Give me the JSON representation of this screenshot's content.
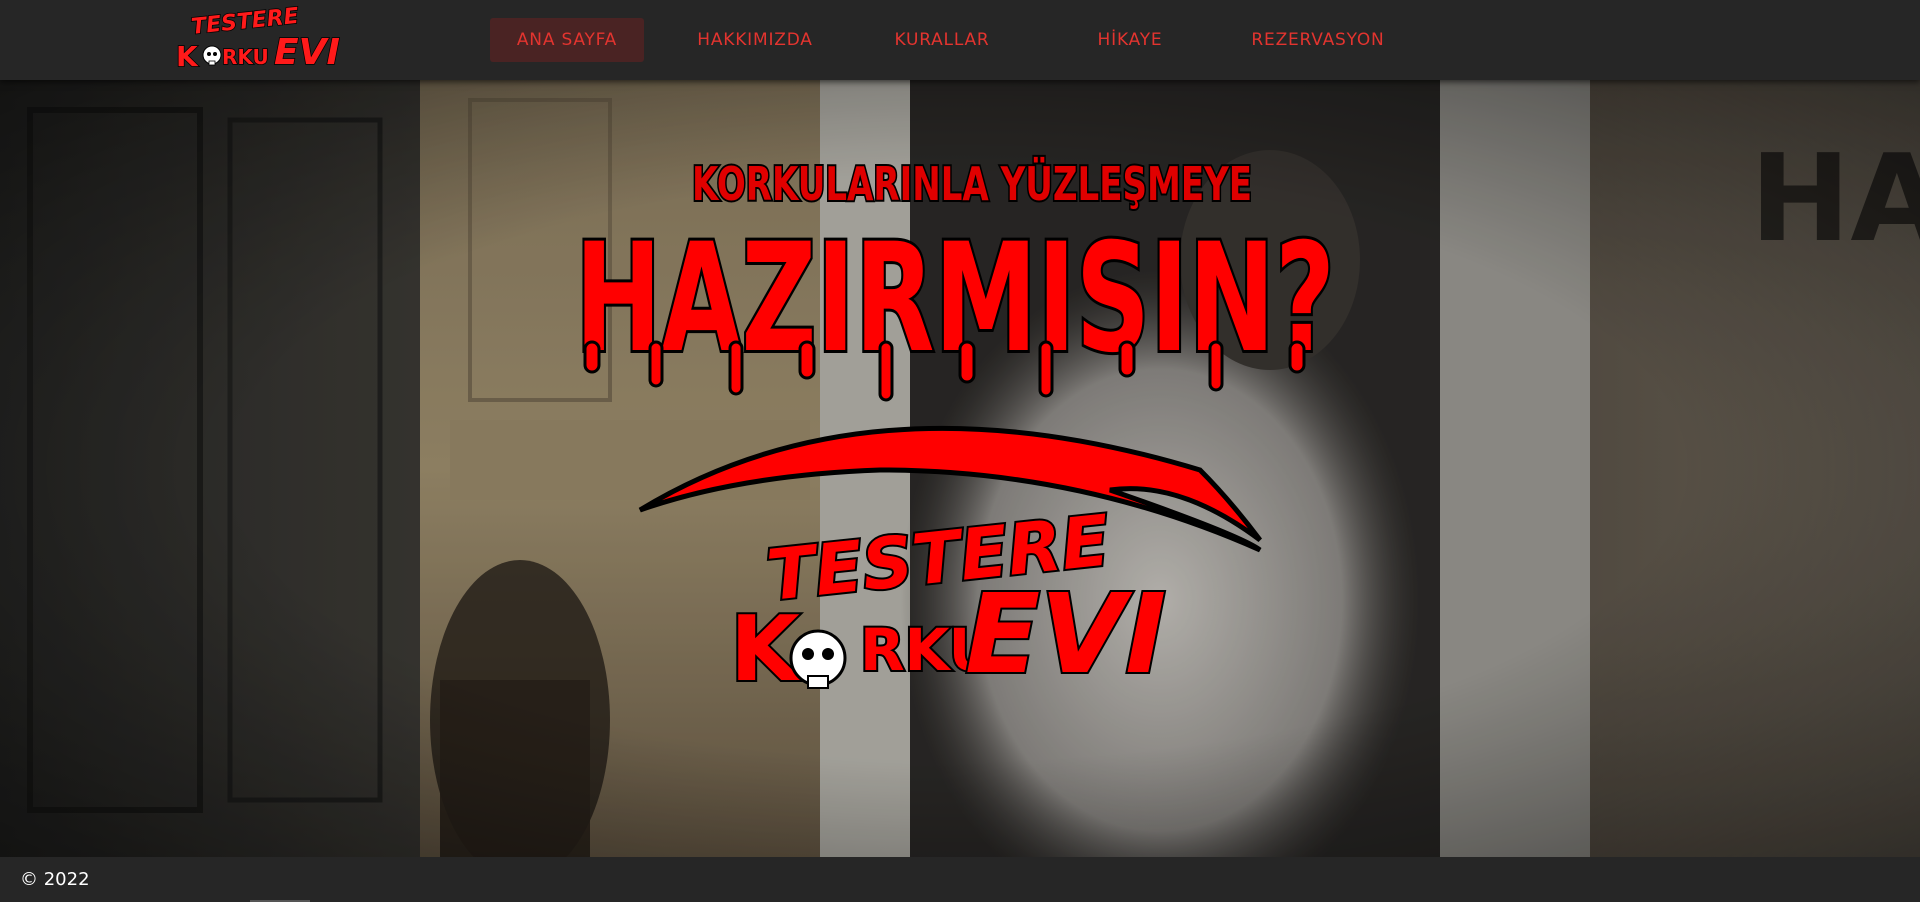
{
  "brand": {
    "logo_line1": "TESTERE",
    "logo_line2a": "K",
    "logo_line2b": "RKU",
    "logo_line2c": "EVI"
  },
  "nav": {
    "items": [
      {
        "label": "ANA SAYFA",
        "active": true
      },
      {
        "label": "HAKKIMIZDA",
        "active": false
      },
      {
        "label": "KURALLAR",
        "active": false
      },
      {
        "label": "HİKAYE",
        "active": false
      },
      {
        "label": "REZERVASYON",
        "active": false
      }
    ]
  },
  "hero": {
    "tagline": "KORKULARINLA YÜZLEŞMEYE",
    "headline": "HAZIRMISIN?",
    "logo_line1": "TESTERE",
    "logo_line2a": "K",
    "logo_line2b": "RKU",
    "logo_line2c": "EVI"
  },
  "footer": {
    "copyright": "© 2022"
  },
  "colors": {
    "accent": "#e3342f",
    "headline_red": "#ff0000",
    "navbar_bg": "#262626",
    "active_tab_bg": "#4a2323"
  }
}
